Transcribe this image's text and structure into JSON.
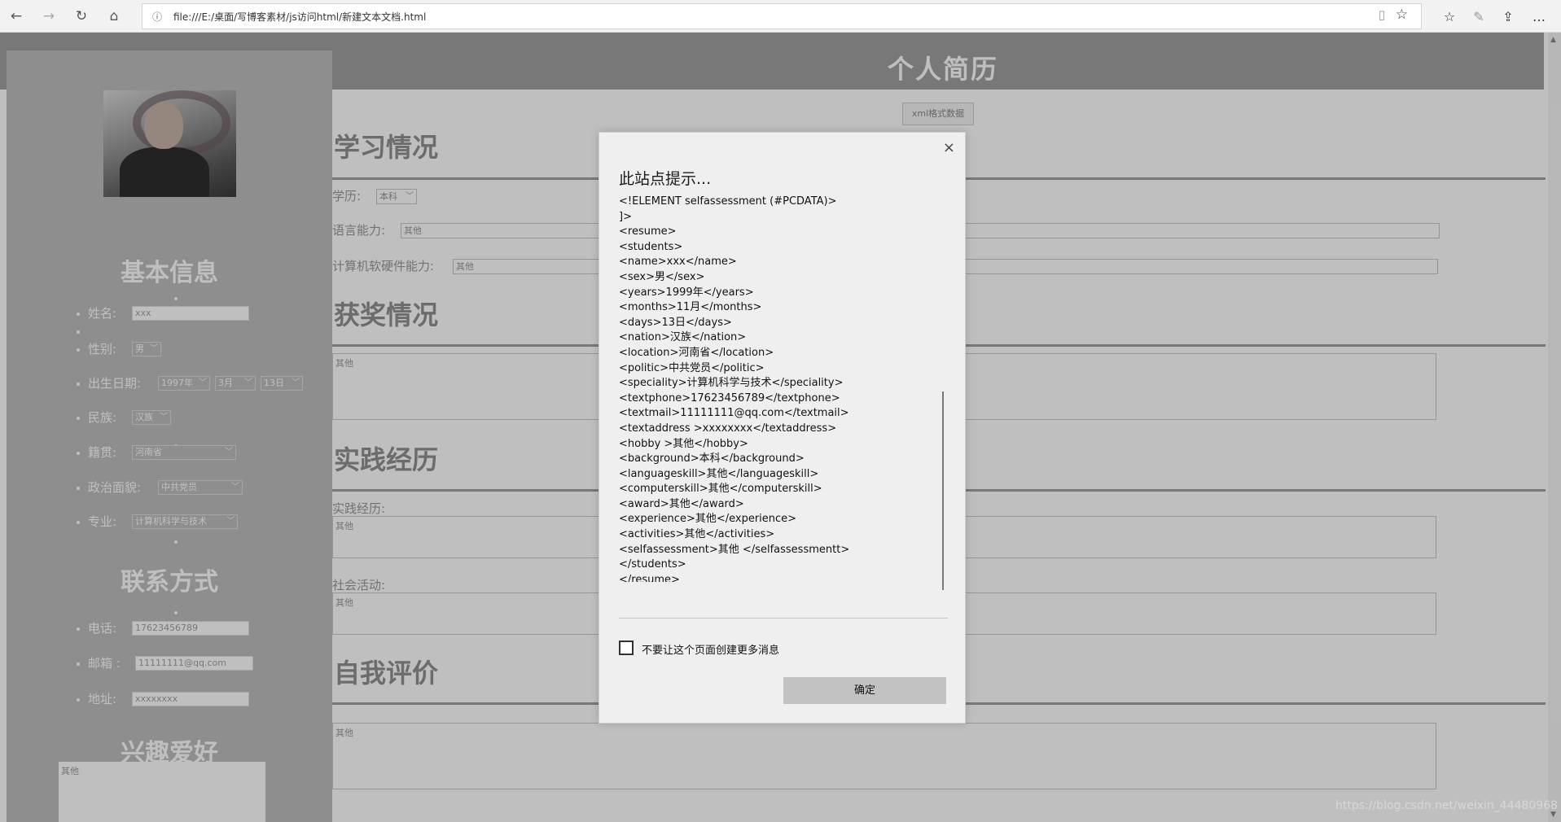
{
  "browser": {
    "url": "file:///E:/桌面/写博客素材/js访问html/新建文本文档.html",
    "icons": [
      "back-arrow",
      "forward-arrow",
      "refresh",
      "home",
      "info",
      "reading-view",
      "favorite-star",
      "favorites-hub",
      "web-note",
      "share"
    ]
  },
  "header": {
    "title": "个人简历"
  },
  "sidebar": {
    "basic_heading": "基本信息",
    "name_label": "姓名:",
    "name_value": "xxx",
    "sex_label": "性别:",
    "sex_value": "男",
    "birth_label": "出生日期:",
    "birth_year": "1997年",
    "birth_month": "3月",
    "birth_day": "13日",
    "nation_label": "民族:",
    "nation_value": "汉族",
    "location_label": "籍贯:",
    "location_value": "河南省",
    "politic_label": "政治面貌:",
    "politic_value": "中共党员",
    "speciality_label": "专业:",
    "speciality_value": "计算机科学与技术",
    "contact_heading": "联系方式",
    "phone_label": "电话:",
    "phone_value": "17623456789",
    "mail_label": "邮箱 :",
    "mail_value": "11111111@qq.com",
    "address_label": "地址:",
    "address_value": "xxxxxxxx",
    "hobby_heading": "兴趣爱好",
    "hobby_value": "其他"
  },
  "main": {
    "xml_button": "xml格式数据",
    "study_heading": "学习情况",
    "background_label": "学历:",
    "background_value": "本科",
    "language_label": "语言能力:",
    "language_value": "其他",
    "computer_label": "计算机软硬件能力:",
    "computer_value": "其他",
    "award_heading": "获奖情况",
    "award_value": "其他",
    "practice_heading": "实践经历",
    "experience_label": "实践经历:",
    "experience_value": "其他",
    "activities_label": "社会活动:",
    "activities_value": "其他",
    "self_heading": "自我评价",
    "self_value": "其他"
  },
  "dialog": {
    "title": "此站点提示...",
    "message_lines": [
      "<!ELEMENT selfassessment (#PCDATA)>",
      "]>",
      "<resume>",
      "<students>",
      "<name>xxx</name>",
      "<sex>男</sex>",
      "<years>1999年</years>",
      "<months>11月</months>",
      "<days>13日</days>",
      "<nation>汉族</nation>",
      "<location>河南省</location>",
      "<politic>中共党员</politic>",
      "<speciality>计算机科学与技术</speciality>",
      "<textphone>17623456789</textphone>",
      "<textmail>11111111@qq.com</textmail>",
      "<textaddress >xxxxxxxx</textaddress>",
      "<hobby >其他</hobby>",
      "<background>本科</background>",
      "<languageskill>其他</languageskill>",
      "<computerskill>其他</computerskill>",
      "<award>其他</award>",
      "<experience>其他</experience>",
      "<activities>其他</activities>",
      "<selfassessment>其他 </selfassessmentt>",
      "</students>",
      "</resume>"
    ],
    "checkbox_label": "不要让这个页面创建更多消息",
    "ok_label": "确定",
    "close_glyph": "×"
  },
  "watermark": "https://blog.csdn.net/weixin_44480968"
}
